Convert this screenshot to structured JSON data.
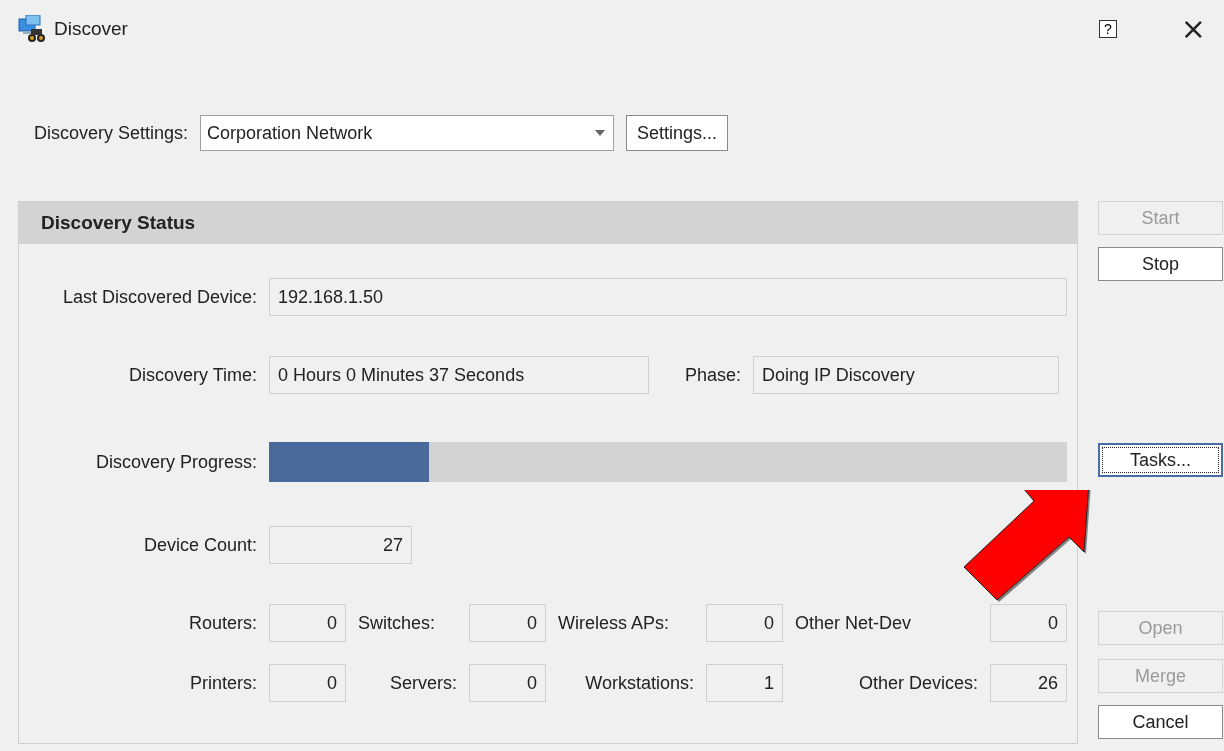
{
  "window": {
    "title": "Discover",
    "help": "?",
    "close": "×"
  },
  "settings": {
    "label": "Discovery Settings:",
    "value": "Corporation Network",
    "button": "Settings..."
  },
  "status": {
    "title": "Discovery Status",
    "last_device": {
      "label": "Last Discovered Device:",
      "value": "192.168.1.50"
    },
    "time": {
      "label": "Discovery Time:",
      "value": "0 Hours 0 Minutes 37 Seconds"
    },
    "phase": {
      "label": "Phase:",
      "value": "Doing IP Discovery"
    },
    "progress": {
      "label": "Discovery Progress:",
      "level": 0.2
    },
    "device_count": {
      "label": "Device Count:",
      "value": "27"
    },
    "counts": [
      {
        "label": "Routers:",
        "value": "0"
      },
      {
        "label": "Switches:",
        "value": "0"
      },
      {
        "label": "Wireless APs:",
        "value": "0"
      },
      {
        "label": "Other Net-Dev",
        "value": "0"
      },
      {
        "label": "Printers:",
        "value": "0"
      },
      {
        "label": "Servers:",
        "value": "0"
      },
      {
        "label": "Workstations:",
        "value": "1"
      },
      {
        "label": "Other Devices:",
        "value": "26"
      }
    ]
  },
  "buttons": [
    {
      "label": "Start",
      "disabled": true,
      "focused": false
    },
    {
      "label": "Stop",
      "disabled": false,
      "focused": false
    },
    {
      "label": "Tasks...",
      "disabled": false,
      "focused": true
    },
    {
      "label": "Open",
      "disabled": true,
      "focused": false
    },
    {
      "label": "Merge",
      "disabled": true,
      "focused": false
    },
    {
      "label": "Cancel",
      "disabled": false,
      "focused": false
    }
  ]
}
